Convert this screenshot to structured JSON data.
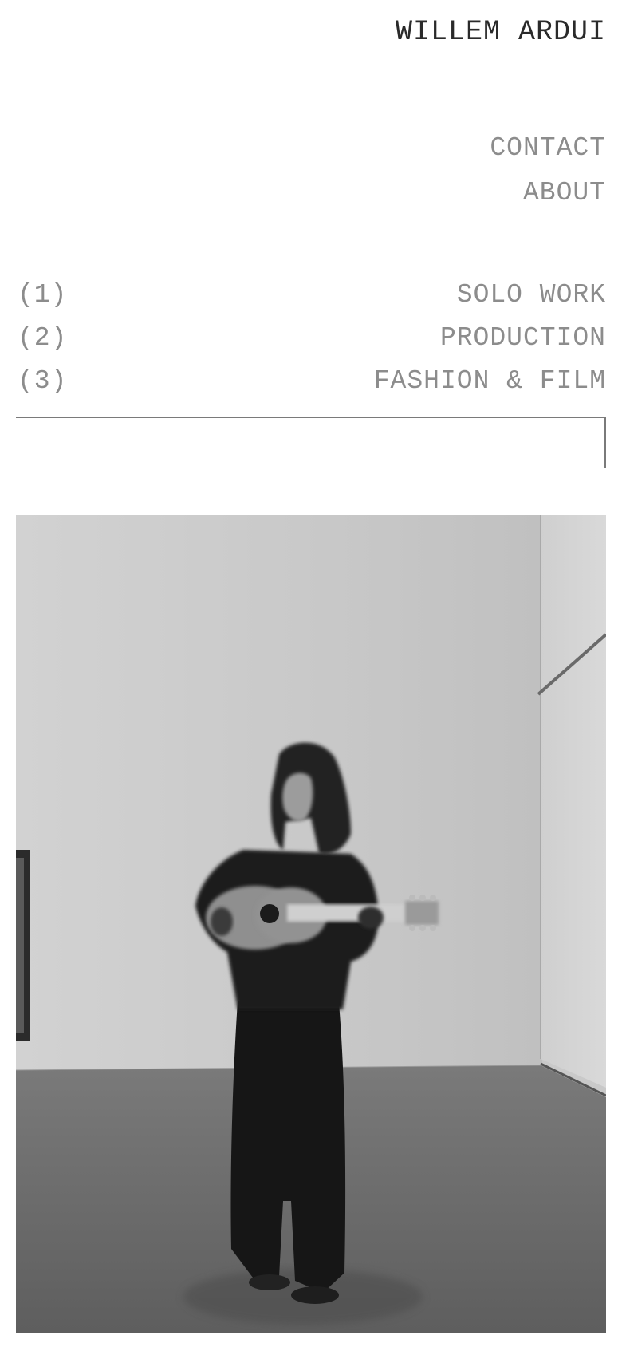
{
  "header": {
    "title": "WILLEM ARDUI"
  },
  "nav": {
    "contact": "CONTACT",
    "about": "ABOUT"
  },
  "projects": [
    {
      "number": "(1)",
      "label": "SOLO WORK"
    },
    {
      "number": "(2)",
      "label": "PRODUCTION"
    },
    {
      "number": "(3)",
      "label": "FASHION & FILM"
    }
  ],
  "colors": {
    "title_text": "#2a2a2a",
    "nav_text": "#8c8c8c",
    "rule": "#7a7a7a",
    "background": "#ffffff"
  },
  "hero": {
    "icon": "photo-musician-with-guitar"
  }
}
